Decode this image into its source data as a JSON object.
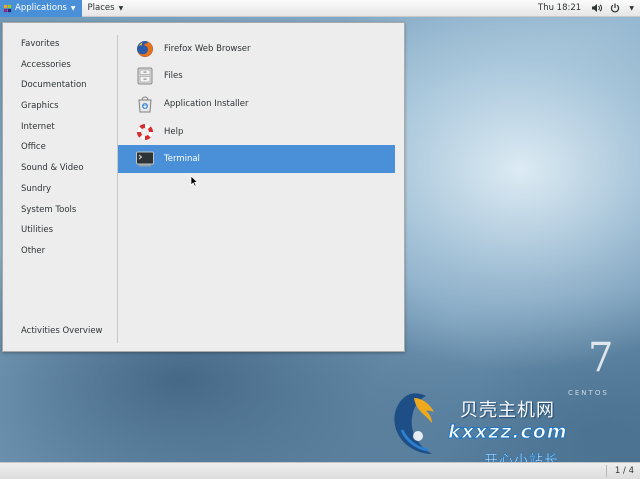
{
  "topbar": {
    "applications_label": "Applications",
    "places_label": "Places",
    "clock": "Thu 18:21"
  },
  "menu": {
    "categories": [
      "Favorites",
      "Accessories",
      "Documentation",
      "Graphics",
      "Internet",
      "Office",
      "Sound & Video",
      "Sundry",
      "System Tools",
      "Utilities",
      "Other"
    ],
    "overview_label": "Activities Overview",
    "apps": [
      {
        "label": "Firefox Web Browser",
        "icon": "firefox-icon"
      },
      {
        "label": "Files",
        "icon": "files-icon"
      },
      {
        "label": "Application Installer",
        "icon": "installer-icon"
      },
      {
        "label": "Help",
        "icon": "help-icon"
      },
      {
        "label": "Terminal",
        "icon": "terminal-icon",
        "selected": true
      }
    ],
    "selected_color": "#4a90d9"
  },
  "bottombar": {
    "workspace": "1 / 4"
  },
  "wallpaper": {
    "os_version": "7",
    "os_name": "CENTOS"
  },
  "watermark": {
    "title": "贝壳主机网",
    "domain": "kxxzz.com",
    "slogan": "开心小站长"
  }
}
